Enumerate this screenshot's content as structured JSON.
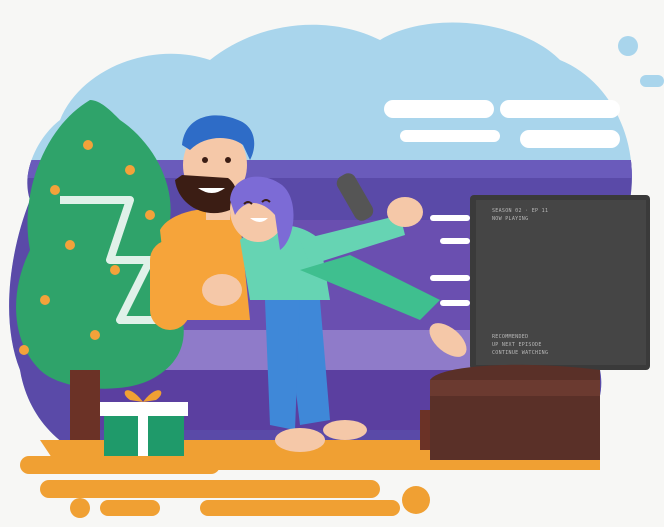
{
  "illustration": {
    "tv_screen_lines_top": [
      "SEASON 02 · EP 11",
      "NOW PLAYING"
    ],
    "tv_screen_lines_bottom": [
      "RECOMMENDED",
      "UP NEXT EPISODE",
      "CONTINUE WATCHING"
    ]
  },
  "colors": {
    "sky": "#a9d5ec",
    "wall": "#5a4aa8",
    "sofa": "#6a4fb0",
    "sofa_light": "#8f7bc9",
    "floor": "#f0a033",
    "tree": "#2fa36a",
    "ornament": "#f3a23a",
    "man_shirt": "#f6a43a",
    "man_hair": "#2e6cc7",
    "beard": "#3b1d14",
    "skin": "#f5c8a8",
    "woman_hair": "#7c6bd6",
    "woman_top": "#66d4b3",
    "jeans": "#3f88d8",
    "tv": "#3a3a3a",
    "tv_stand": "#5a3028",
    "gift_box": "#1f9a6a",
    "gift_ribbon": "#ffffff"
  },
  "icons": [
    "christmas-tree-icon",
    "gift-box-icon",
    "television-icon",
    "remote-control-icon"
  ]
}
